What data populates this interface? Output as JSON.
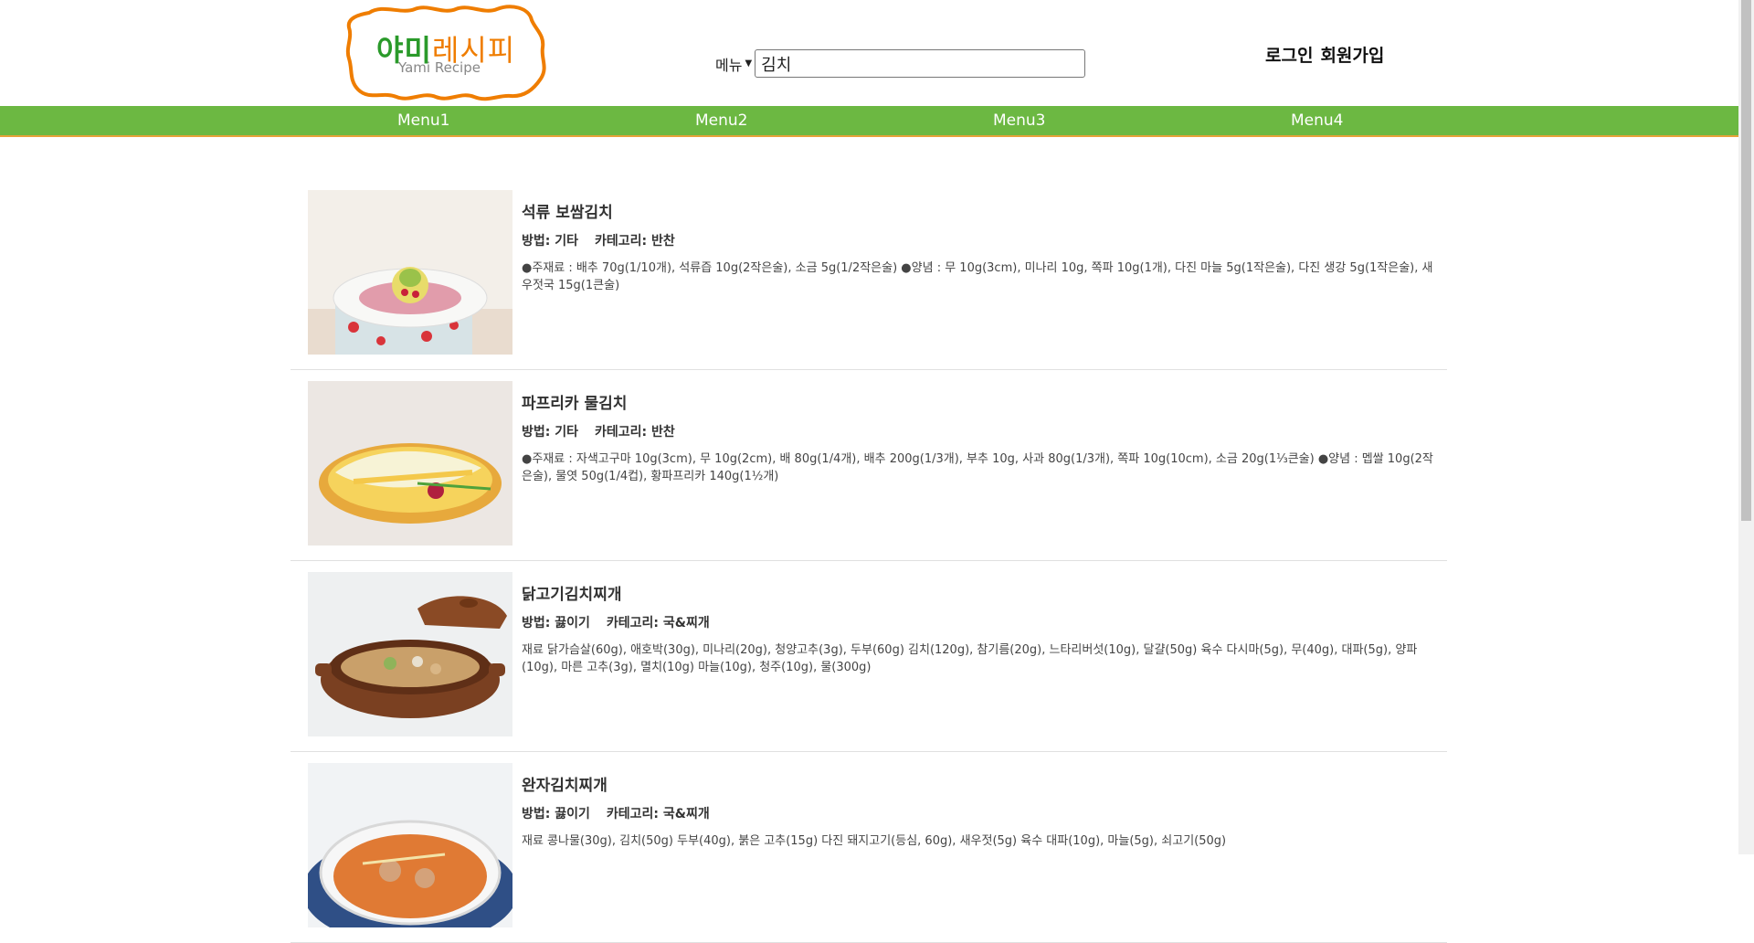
{
  "logo": {
    "korean_green": "야미",
    "korean_orange": "레시피",
    "english": "Yami Recipe"
  },
  "search": {
    "select_label": "메뉴",
    "value": "김치"
  },
  "auth": {
    "login": "로그인",
    "signup": "회원가입"
  },
  "nav": [
    "Menu1",
    "Menu2",
    "Menu3",
    "Menu4"
  ],
  "colors": {
    "nav_bg": "#6cb842",
    "nav_border": "#e7a23a",
    "logo_green": "#2a9a2a",
    "logo_orange": "#ef7d00"
  },
  "recipes": [
    {
      "title": "석류 보쌈김치",
      "method_label": "방법: 기타",
      "category_label": "카테고리: 반찬",
      "desc": "●주재료 : 배추 70g(1/10개), 석류즙 10g(2작은술), 소금 5g(1/2작은술) ●양념 : 무 10g(3cm), 미나리 10g, 쪽파 10g(1개), 다진 마늘 5g(1작은술), 다진 생강 5g(1작은술), 새우젓국 15g(1큰술)"
    },
    {
      "title": "파프리카 물김치",
      "method_label": "방법: 기타",
      "category_label": "카테고리: 반찬",
      "desc": "●주재료 : 자색고구마 10g(3cm), 무 10g(2cm), 배 80g(1/4개), 배추 200g(1/3개), 부추 10g, 사과 80g(1/3개), 쪽파 10g(10cm), 소금 20g(1⅓큰술) ●양념 : 멥쌀 10g(2작은술), 물엿 50g(1/4컵), 황파프리카 140g(1½개)"
    },
    {
      "title": "닭고기김치찌개",
      "method_label": "방법: 끓이기",
      "category_label": "카테고리: 국&찌개",
      "desc": "재료 닭가슴살(60g), 애호박(30g), 미나리(20g), 청양고추(3g), 두부(60g) 김치(120g), 참기름(20g), 느타리버섯(10g), 달걀(50g) 육수 다시마(5g), 무(40g), 대파(5g), 양파(10g), 마른 고추(3g), 멸치(10g) 마늘(10g), 청주(10g), 물(300g)"
    },
    {
      "title": "완자김치찌개",
      "method_label": "방법: 끓이기",
      "category_label": "카테고리: 국&찌개",
      "desc": "재료 콩나물(30g), 김치(50g) 두부(40g), 붉은 고추(15g) 다진 돼지고기(등심, 60g), 새우젓(5g) 육수 대파(10g), 마늘(5g), 쇠고기(50g)"
    }
  ]
}
